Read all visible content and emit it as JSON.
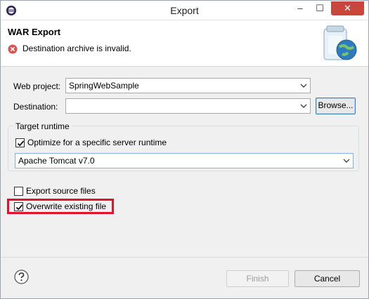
{
  "window": {
    "title": "Export",
    "controls": {
      "minimize": "–",
      "maximize": "☐",
      "close": "✕"
    }
  },
  "banner": {
    "title": "WAR Export",
    "message": "Destination archive is invalid."
  },
  "form": {
    "web_project_label": "Web project:",
    "web_project_value": "SpringWebSample",
    "destination_label": "Destination:",
    "destination_value": "",
    "browse_label": "Browse..."
  },
  "target_runtime": {
    "legend": "Target runtime",
    "optimize_label": "Optimize for a specific server runtime",
    "optimize_checked": true,
    "runtime_value": "Apache Tomcat v7.0"
  },
  "options": {
    "export_source_label": "Export source files",
    "export_source_checked": false,
    "overwrite_label": "Overwrite existing file",
    "overwrite_checked": true
  },
  "footer": {
    "finish_label": "Finish",
    "cancel_label": "Cancel"
  },
  "colors": {
    "error_red": "#d9534f",
    "highlight_red": "#e3122a",
    "close_button": "#c9463d",
    "focus_blue": "#7eb4ea"
  },
  "icons": {
    "app": "eclipse-icon",
    "error": "error-icon",
    "banner": "war-jar-globe-icon",
    "help": "help-icon",
    "dropdown": "chevron-down-icon",
    "check": "checkmark-icon"
  }
}
